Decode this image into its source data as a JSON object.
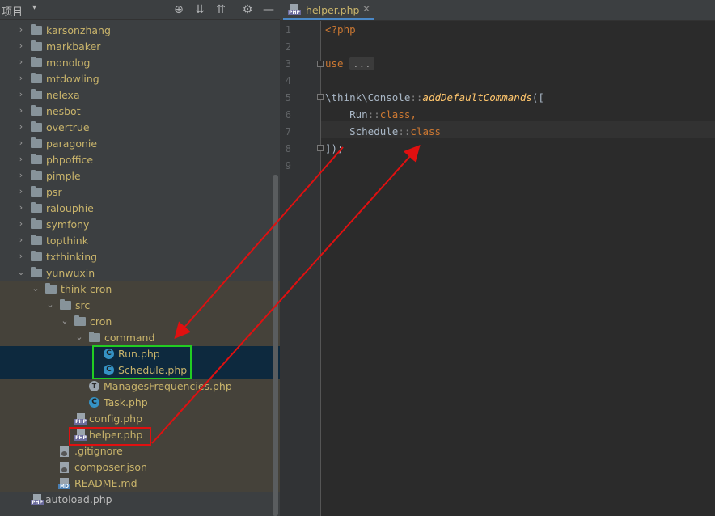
{
  "project_pane": {
    "title": "项目",
    "dropdown_glyph": "▾"
  },
  "tree": [
    {
      "depth": 1,
      "expanded": false,
      "label": "karsonzhang",
      "color": "y"
    },
    {
      "depth": 1,
      "expanded": false,
      "label": "markbaker",
      "color": "y"
    },
    {
      "depth": 1,
      "expanded": false,
      "label": "monolog",
      "color": "y"
    },
    {
      "depth": 1,
      "expanded": false,
      "label": "mtdowling",
      "color": "y"
    },
    {
      "depth": 1,
      "expanded": false,
      "label": "nelexa",
      "color": "y"
    },
    {
      "depth": 1,
      "expanded": false,
      "label": "nesbot",
      "color": "y"
    },
    {
      "depth": 1,
      "expanded": false,
      "label": "overtrue",
      "color": "y"
    },
    {
      "depth": 1,
      "expanded": false,
      "label": "paragonie",
      "color": "y"
    },
    {
      "depth": 1,
      "expanded": false,
      "label": "phpoffice",
      "color": "y"
    },
    {
      "depth": 1,
      "expanded": false,
      "label": "pimple",
      "color": "y"
    },
    {
      "depth": 1,
      "expanded": false,
      "label": "psr",
      "color": "y"
    },
    {
      "depth": 1,
      "expanded": false,
      "label": "ralouphie",
      "color": "y"
    },
    {
      "depth": 1,
      "expanded": false,
      "label": "symfony",
      "color": "y"
    },
    {
      "depth": 1,
      "expanded": false,
      "label": "topthink",
      "color": "y"
    },
    {
      "depth": 1,
      "expanded": false,
      "label": "txthinking",
      "color": "y"
    },
    {
      "depth": 1,
      "expanded": true,
      "label": "yunwuxin",
      "color": "y"
    },
    {
      "depth": 2,
      "expanded": true,
      "label": "think-cron",
      "color": "y",
      "hl": true
    },
    {
      "depth": 3,
      "expanded": true,
      "label": "src",
      "color": "y",
      "hl": true
    },
    {
      "depth": 4,
      "expanded": true,
      "label": "cron",
      "color": "y",
      "hl": true
    },
    {
      "depth": 5,
      "expanded": true,
      "label": "command",
      "color": "y",
      "hl": true
    },
    {
      "depth": 6,
      "type": "class",
      "label": "Run.php",
      "color": "y",
      "sel": true
    },
    {
      "depth": 6,
      "type": "class",
      "label": "Schedule.php",
      "color": "y",
      "sel": true
    },
    {
      "depth": 5,
      "type": "trait",
      "label": "ManagesFrequencies.php",
      "color": "y",
      "hl": true
    },
    {
      "depth": 5,
      "type": "class",
      "label": "Task.php",
      "color": "y",
      "hl": true
    },
    {
      "depth": 4,
      "type": "php",
      "label": "config.php",
      "color": "y",
      "hl": true
    },
    {
      "depth": 4,
      "type": "php",
      "label": "helper.php",
      "color": "y",
      "hl": true
    },
    {
      "depth": 3,
      "type": "gitignore",
      "label": ".gitignore",
      "color": "y",
      "hl": true
    },
    {
      "depth": 3,
      "type": "json",
      "label": "composer.json",
      "color": "y",
      "hl": true
    },
    {
      "depth": 3,
      "type": "md",
      "label": "README.md",
      "color": "y",
      "hl": true
    },
    {
      "depth": 1,
      "type": "php",
      "label": "autoload.php",
      "color": "n"
    }
  ],
  "icons": {
    "class_glyph": "C",
    "php_glyph": "PHP",
    "md_glyph": "MD",
    "trait_glyph": "T",
    "locate": "⊕",
    "expand_all": "⇊",
    "collapse_all": "⇈",
    "settings": "⚙",
    "hide": "—",
    "close": "✕"
  },
  "editor": {
    "tab_label": "helper.php",
    "line_numbers": [
      "1",
      "2",
      "3",
      "4",
      "5",
      "6",
      "7",
      "8",
      "9"
    ],
    "code": {
      "l1": "<?php",
      "l3_kw": "use",
      "l3_fold": "...",
      "l6_ns": "\\think\\Console",
      "l6_sep": "::",
      "l6_fn": "addDefaultCommands",
      "l6_open": "([",
      "l7_indent": "    ",
      "l7_cls": "Run",
      "l7_sep": "::",
      "l7_kw": "class,",
      "l8_indent": "    ",
      "l8_cls": "Schedule",
      "l8_sep": "::",
      "l8_kw": "class",
      "l9_close": "]);"
    }
  },
  "annotations": {
    "green_box_color": "#22cc22",
    "red_box_color": "#e01010",
    "arrow_color": "#e01010"
  }
}
